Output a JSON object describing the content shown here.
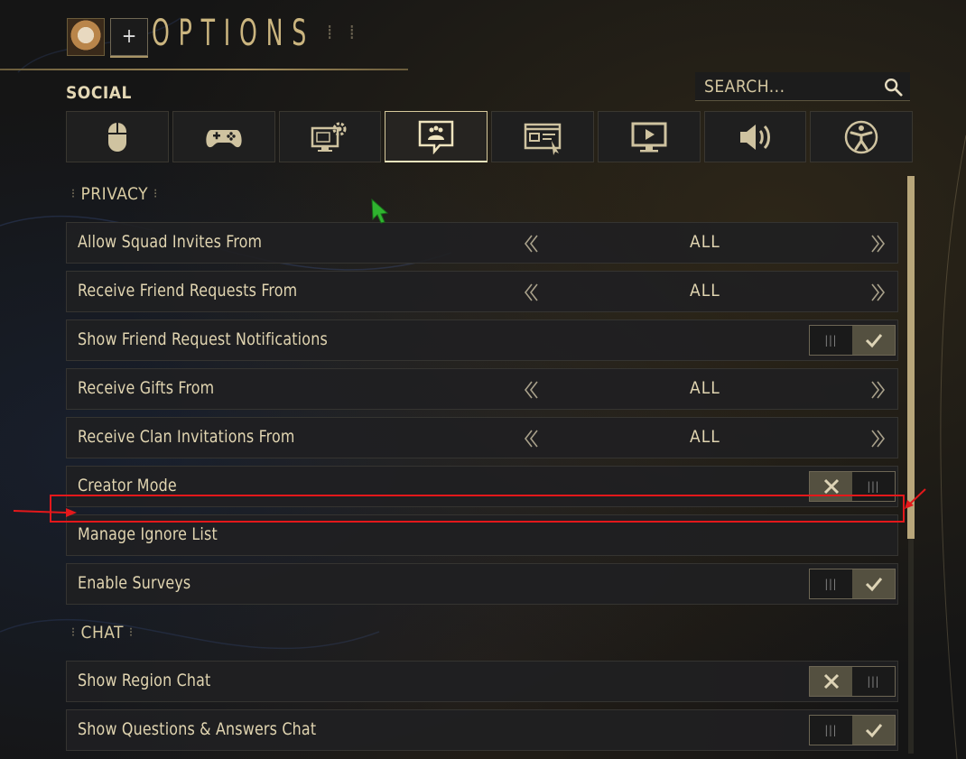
{
  "header": {
    "add_label": "+",
    "title": "OPTIONS",
    "section": "SOCIAL"
  },
  "search": {
    "placeholder": "SEARCH..."
  },
  "tabs": [
    {
      "icon": "mouse-icon"
    },
    {
      "icon": "gamepad-icon"
    },
    {
      "icon": "system-settings-icon"
    },
    {
      "icon": "social-chat-icon",
      "active": true
    },
    {
      "icon": "interface-icon"
    },
    {
      "icon": "display-icon"
    },
    {
      "icon": "audio-icon"
    },
    {
      "icon": "accessibility-icon"
    }
  ],
  "privacy": {
    "title": "PRIVACY",
    "rows": [
      {
        "label": "Allow Squad Invites From",
        "value": "ALL"
      },
      {
        "label": "Receive Friend Requests From",
        "value": "ALL"
      },
      {
        "label": "Show Friend Request Notifications",
        "toggle": true
      },
      {
        "label": "Receive Gifts From",
        "value": "ALL"
      },
      {
        "label": "Receive Clan Invitations From",
        "value": "ALL"
      },
      {
        "label": "Creator Mode",
        "toggle": false
      },
      {
        "label": "Manage Ignore List"
      },
      {
        "label": "Enable Surveys",
        "toggle": true
      }
    ]
  },
  "chat": {
    "title": "CHAT",
    "rows": [
      {
        "label": "Show Region Chat",
        "toggle": false
      },
      {
        "label": "Show Questions & Answers Chat",
        "toggle": true
      }
    ]
  },
  "colors": {
    "accent": "#cbb57f",
    "highlight": "#e3181b",
    "cursor": "#2fb52f"
  }
}
